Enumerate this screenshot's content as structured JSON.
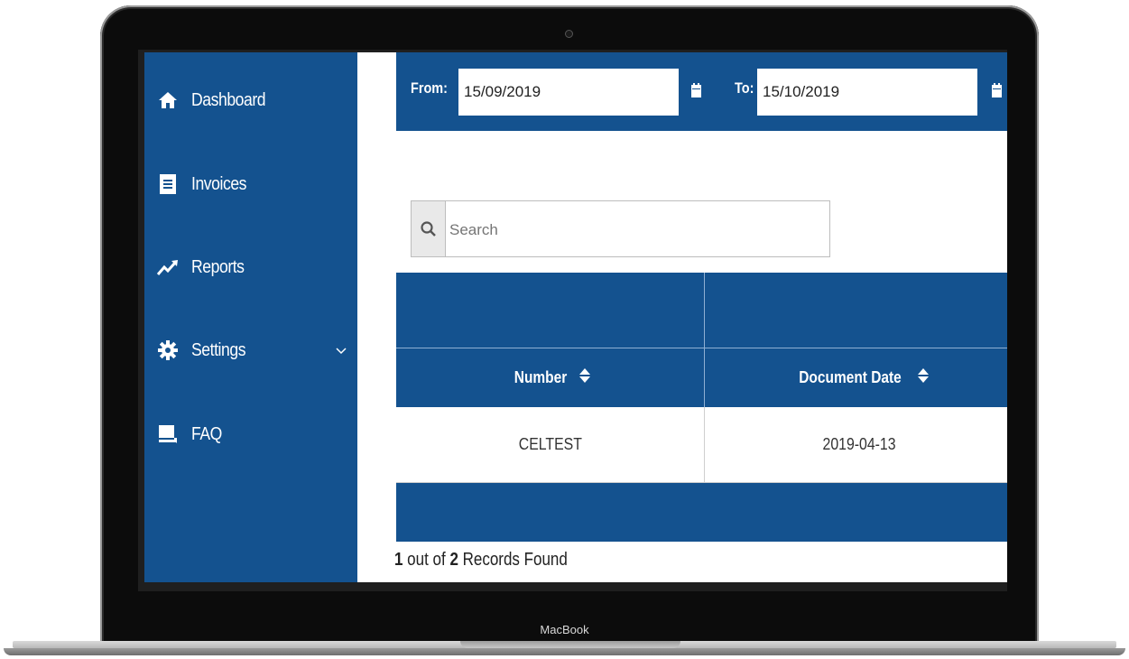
{
  "device": {
    "brand_label": "MacBook"
  },
  "sidebar": {
    "items": [
      {
        "label": "Dashboard",
        "icon": "home-icon"
      },
      {
        "label": "Invoices",
        "icon": "document-icon"
      },
      {
        "label": "Reports",
        "icon": "trend-icon"
      },
      {
        "label": "Settings",
        "icon": "gear-icon",
        "has_submenu": true
      },
      {
        "label": "FAQ",
        "icon": "chat-icon"
      }
    ],
    "background": "#14528f"
  },
  "filters": {
    "from_label": "From:",
    "from_value": "15/09/2019",
    "to_label": "To:",
    "to_value": "15/10/2019"
  },
  "search": {
    "placeholder": "Search",
    "value": ""
  },
  "table": {
    "columns": [
      {
        "label": "Number",
        "sortable": true
      },
      {
        "label": "Document Date",
        "sortable": true
      }
    ],
    "rows": [
      [
        "CELTEST",
        "2019-04-13"
      ]
    ]
  },
  "records": {
    "shown": "1",
    "middle": " out of ",
    "total": "2",
    "suffix": " Records Found"
  },
  "colors": {
    "primary": "#14528f"
  }
}
